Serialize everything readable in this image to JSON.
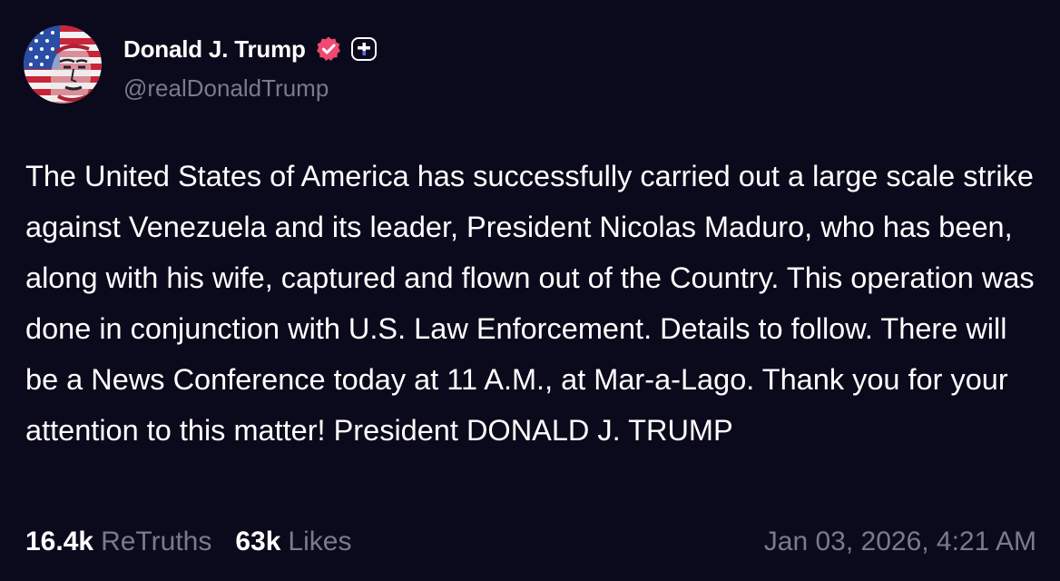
{
  "author": {
    "display_name": "Donald J. Trump",
    "handle": "@realDonaldTrump",
    "avatar_icon": "flag-portrait-avatar",
    "verified_icon": "verified-badge-icon",
    "verified_color": "#ef4a72",
    "plus_icon": "plus-badge-icon"
  },
  "post": {
    "text": "The United States of America has successfully carried out a large scale strike against Venezuela and its leader, President Nicolas Maduro, who has been, along with his wife, captured and flown out of the Country. This operation was done in conjunction with U.S. Law Enforcement. Details to follow. There will be a News Conference today at 11 A.M., at Mar-a-Lago. Thank you for your attention to this matter! President DONALD J. TRUMP",
    "timestamp": "Jan 03, 2026, 4:21 AM"
  },
  "stats": {
    "retruths_count": "16.4k",
    "retruths_label": "ReTruths",
    "likes_count": "63k",
    "likes_label": "Likes"
  },
  "colors": {
    "background": "#0b0a1c",
    "text_primary": "#ffffff",
    "text_secondary": "#7b7a8a"
  }
}
